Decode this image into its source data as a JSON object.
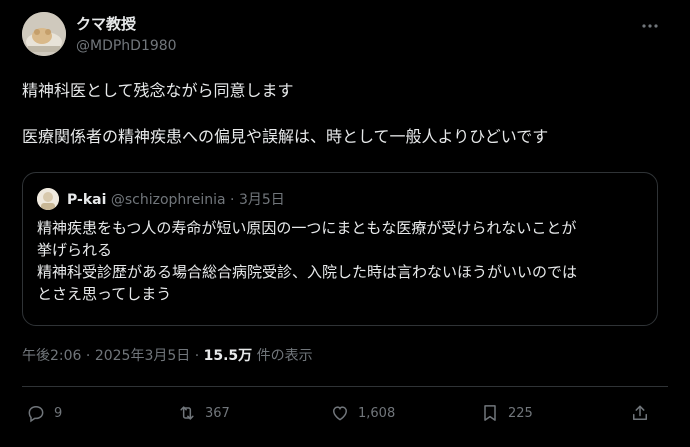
{
  "author": {
    "display_name": "クマ教授",
    "handle": "@MDPhD1980"
  },
  "tweet": {
    "line1": "精神科医として残念ながら同意します",
    "line2": "医療関係者の精神疾患への偏見や誤解は、時として一般人よりひどいです"
  },
  "quote": {
    "name": "P-kai",
    "handle": "@schizophreinia",
    "separator": "·",
    "date": "3月5日",
    "lines": [
      "精神疾患をもつ人の寿命が短い原因の一つにまともな医療が受けられないことが",
      "挙げられる",
      "精神科受診歴がある場合総合病院受診、入院した時は言わないほうがいいのでは",
      "とさえ思ってしまう"
    ]
  },
  "meta": {
    "time": "午後2:06",
    "dot1": "·",
    "date": "2025年3月5日",
    "dot2": "·",
    "views": "15.5万",
    "views_label": "件の表示"
  },
  "actions": {
    "replies": "9",
    "reposts": "367",
    "likes": "1,608",
    "bookmarks": "225"
  },
  "icons": {
    "more": "more-icon",
    "reply": "reply-icon",
    "repost": "repost-icon",
    "like": "heart-icon",
    "bookmark": "bookmark-icon",
    "share": "share-icon"
  },
  "colors": {
    "background": "#000000",
    "text": "#e7e9ea",
    "secondary": "#71767b",
    "border": "#2f3336"
  }
}
